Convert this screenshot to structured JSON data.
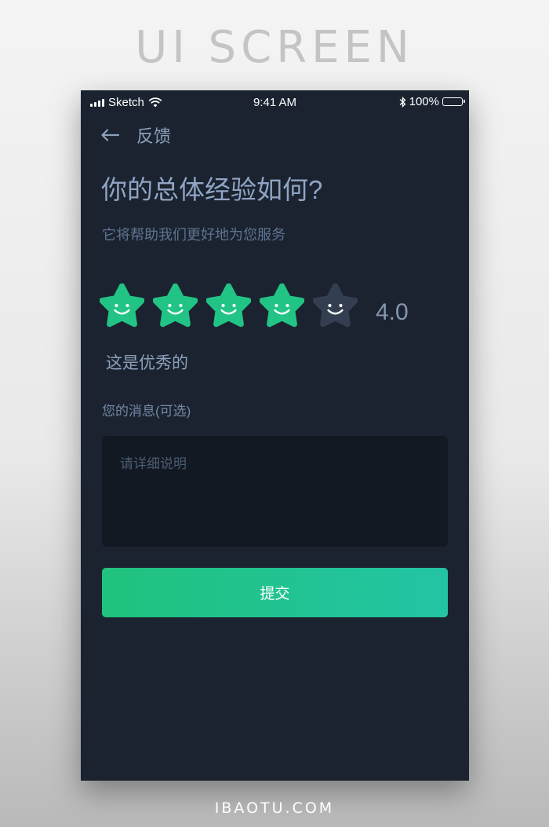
{
  "header": {
    "text": "UI SCREEN"
  },
  "footer": {
    "text": "IBAOTU.COM"
  },
  "status_bar": {
    "carrier": "Sketch",
    "time": "9:41 AM",
    "battery": "100%"
  },
  "nav": {
    "title": "反馈",
    "back_icon": "arrow-left-icon"
  },
  "page": {
    "title": "你的总体经验如何?",
    "subtitle": "它将帮助我们更好地为您服务"
  },
  "rating": {
    "value": 4.0,
    "max": 5,
    "score_text": "4.0",
    "label": "这是优秀的",
    "active_color": "#22c486",
    "inactive_color": "#333f51"
  },
  "message": {
    "label": "您的消息(可选)",
    "placeholder": "请详细说明"
  },
  "submit": {
    "label": "提交"
  },
  "colors": {
    "background": "#1b2330",
    "accent": "#21c27d"
  }
}
